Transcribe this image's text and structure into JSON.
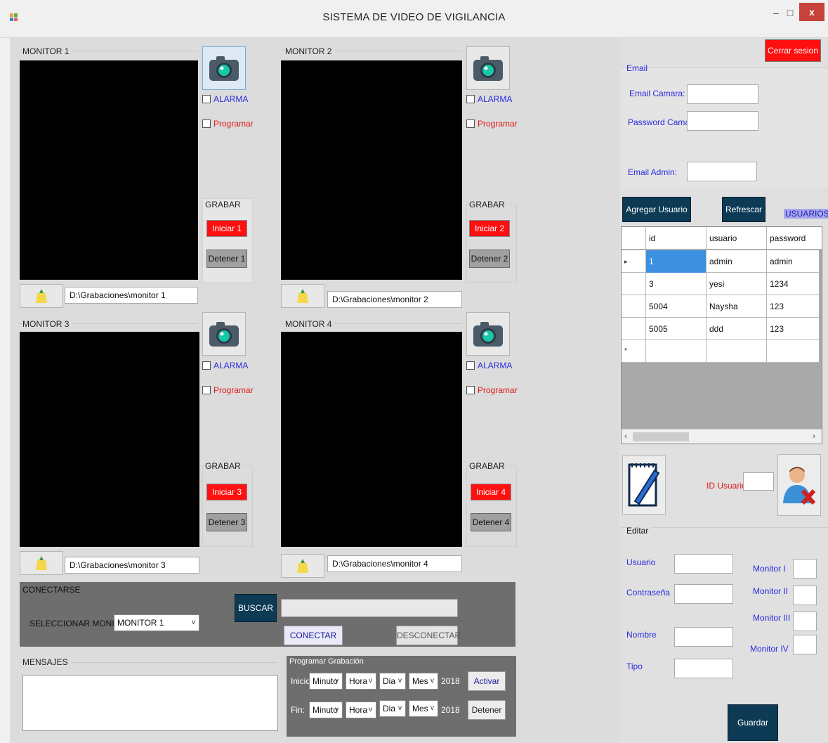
{
  "window": {
    "title": "SISTEMA DE VIDEO DE VIGILANCIA",
    "minimize": "–",
    "maximize": "□",
    "close": "x"
  },
  "monitors": [
    {
      "title": "MONITOR 1",
      "alarma": "ALARMA",
      "programar": "Programar",
      "grabar": "GRABAR",
      "iniciar": "Iniciar 1",
      "detener": "Detener 1",
      "path": "D:\\Grabaciones\\monitor 1"
    },
    {
      "title": "MONITOR 2",
      "alarma": "ALARMA",
      "programar": "Programar",
      "grabar": "GRABAR",
      "iniciar": "Iniciar 2",
      "detener": "Detener 2",
      "path": "D:\\Grabaciones\\monitor 2"
    },
    {
      "title": "MONITOR 3",
      "alarma": "ALARMA",
      "programar": "Programar",
      "grabar": "GRABAR",
      "iniciar": "Iniciar 3",
      "detener": "Detener 3",
      "path": "D:\\Grabaciones\\monitor 3"
    },
    {
      "title": "MONITOR 4",
      "alarma": "ALARMA",
      "programar": "Programar",
      "grabar": "GRABAR",
      "iniciar": "Iniciar 4",
      "detener": "Detener 4",
      "path": "D:\\Grabaciones\\monitor 4"
    }
  ],
  "conectarse": {
    "title": "CONECTARSE",
    "select_label": "SELECCIONAR MONITOR:",
    "select_value": "MONITOR 1",
    "buscar": "BUSCAR",
    "search_value": "",
    "conectar": "CONECTAR",
    "desconectar": "DESCONECTAR"
  },
  "mensajes": {
    "title": "MENSAJES",
    "content": ""
  },
  "programar_grabacion": {
    "title": "Programar Grabación",
    "inicio_label": "Inicio:",
    "fin_label": "Fin:",
    "minuto": "Minuto",
    "hora": "Hora",
    "dia": "Dia",
    "mes": "Mes",
    "year": "2018",
    "activar": "Activar",
    "detener": "Detener"
  },
  "session": {
    "cerrar": "Cerrar sesion"
  },
  "email": {
    "title": "Email",
    "email_camara": "Email Camara:",
    "password_camara": "Password Camara:",
    "email_admin": "Email Admin:"
  },
  "users": {
    "agregar": "Agregar Usuario",
    "refrescar": "Refrescar",
    "label": "USUARIOS",
    "columns": [
      "id",
      "usuario",
      "password"
    ],
    "rows": [
      [
        "1",
        "admin",
        "admin"
      ],
      [
        "3",
        "yesi",
        "1234"
      ],
      [
        "5004",
        "Naysha",
        "123"
      ],
      [
        "5005",
        "ddd",
        "123"
      ]
    ],
    "new_row_marker": "*",
    "current_row_marker": "▸",
    "id_usuario": "ID Usuario"
  },
  "editar": {
    "title": "Editar",
    "usuario": "Usuario",
    "contrasena": "Contraseña",
    "nombre": "Nombre",
    "tipo": "Tipo",
    "monitor_i": "Monitor I",
    "monitor_ii": "Monitor II",
    "monitor_iii": "Monitor III",
    "monitor_iv": "Monitor IV",
    "guardar": "Guardar"
  },
  "colors": {
    "video_bg": "#000000",
    "red_button": "#ff1010",
    "dark_button": "#0d3a55",
    "panel_gray": "#6e6e6e",
    "selection_blue": "#3d8fe0",
    "label_blue": "#2a2ae0",
    "label_red": "#e01a1a"
  }
}
